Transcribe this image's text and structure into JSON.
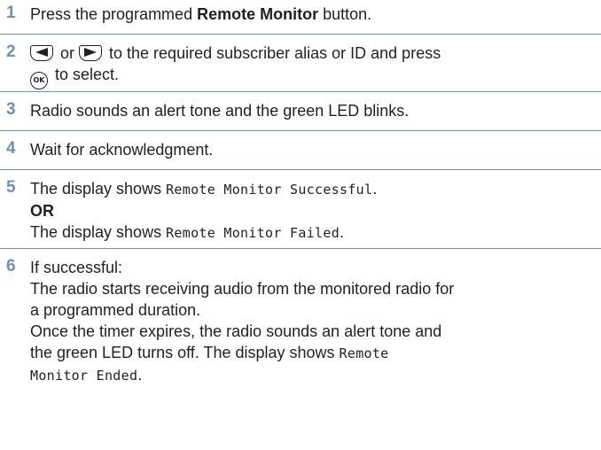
{
  "steps": [
    {
      "num": "1",
      "pre": "Press the programmed ",
      "bold": "Remote Monitor",
      "post": " button."
    },
    {
      "num": "2",
      "mid": " or ",
      "line1": " to the required subscriber alias or ID and press",
      "line2": " to select.",
      "keys": [
        "left-arrow-key",
        "right-arrow-key",
        "ok-key"
      ],
      "ok_label": "OK"
    },
    {
      "num": "3",
      "text": "Radio sounds an alert tone and the green LED blinks."
    },
    {
      "num": "4",
      "text": "Wait for acknowledgment."
    },
    {
      "num": "5",
      "pre1": "The display shows ",
      "mono1": "Remote Monitor Successful",
      "post1": ".",
      "or": "OR",
      "pre2": "The display shows ",
      "mono2": "Remote Monitor Failed",
      "post2": "."
    },
    {
      "num": "6",
      "l1": "If successful:",
      "l2": "The radio starts receiving audio from the monitored radio for",
      "l3": "a programmed duration.",
      "l4": "Once the timer expires, the radio sounds an alert tone and",
      "l5": "the green LED turns off. The display shows ",
      "mono_a": "Remote",
      "mono_b": "Monitor Ended",
      "l6_post": "."
    }
  ],
  "colors": {
    "step_number": "#6b8fb5",
    "rule": "#6b8fb5",
    "text": "#231f20"
  }
}
